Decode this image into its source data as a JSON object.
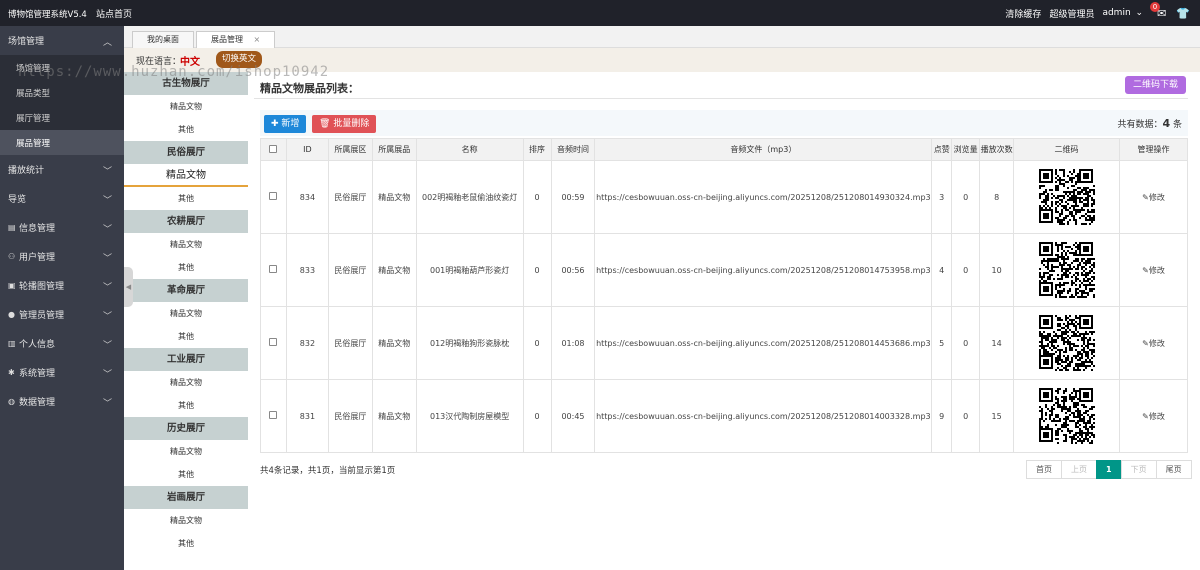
{
  "topbar": {
    "brand": "博物馆管理系统V5.4",
    "home": "站点首页",
    "clear_cache": "清除缓存",
    "role": "超级管理员",
    "user": "admin",
    "msg_count": "0"
  },
  "sidebar": {
    "groups": [
      {
        "label": "场馆管理"
      },
      {
        "label": "播放统计"
      },
      {
        "label": "导览"
      },
      {
        "label": "信息管理"
      },
      {
        "label": "用户管理"
      },
      {
        "label": "轮播图管理"
      },
      {
        "label": "管理员管理"
      },
      {
        "label": "个人信息"
      },
      {
        "label": "系统管理"
      },
      {
        "label": "数据管理"
      }
    ],
    "sub_items": [
      "场馆管理",
      "展品类型",
      "展厅管理",
      "展品管理"
    ]
  },
  "tabs": [
    {
      "label": "我的桌面"
    },
    {
      "label": "展品管理",
      "close": "×"
    }
  ],
  "lang": {
    "label": "现在语言：",
    "current": "中文",
    "switch": "切换英文"
  },
  "watermark": "https://www.huzhan.com/ishop10942",
  "hallnav": [
    {
      "hall": "古生物展厅",
      "items": [
        "精品文物",
        "其他"
      ]
    },
    {
      "hall": "民俗展厅",
      "items": [
        "精品文物",
        "其他"
      ]
    },
    {
      "hall": "农耕展厅",
      "items": [
        "精品文物",
        "其他"
      ]
    },
    {
      "hall": "革命展厅",
      "items": [
        "精品文物",
        "其他"
      ]
    },
    {
      "hall": "工业展厅",
      "items": [
        "精品文物",
        "其他"
      ]
    },
    {
      "hall": "历史展厅",
      "items": [
        "精品文物",
        "其他"
      ]
    },
    {
      "hall": "岩画展厅",
      "items": [
        "精品文物",
        "其他"
      ]
    }
  ],
  "main": {
    "title": "精品文物展品列表：",
    "qr_download": "二维码下载",
    "add": "新增",
    "batch_delete": "批量删除",
    "total_prefix": "共有数据：",
    "total": "4",
    "total_suffix": " 条",
    "columns": [
      "ID",
      "所属展区",
      "所属展品",
      "名称",
      "排序",
      "音频时间",
      "音频文件（mp3）",
      "点赞",
      "浏览量",
      "播放次数",
      "二维码",
      "管理操作"
    ],
    "rows": [
      {
        "id": "834",
        "area": "民俗展厅",
        "category": "精品文物",
        "name": "002明褐釉老鼠偷油纹瓷灯",
        "sort": "0",
        "duration": "00:59",
        "audio": "https://cesbowuuan.oss-cn-beijing.aliyuncs.com/20251208/251208014930324.mp3",
        "likes": "3",
        "views": "0",
        "plays": "8",
        "edit": "修改"
      },
      {
        "id": "833",
        "area": "民俗展厅",
        "category": "精品文物",
        "name": "001明褐釉葫芦形瓷灯",
        "sort": "0",
        "duration": "00:56",
        "audio": "https://cesbowuuan.oss-cn-beijing.aliyuncs.com/20251208/251208014753958.mp3",
        "likes": "4",
        "views": "0",
        "plays": "10",
        "edit": "修改"
      },
      {
        "id": "832",
        "area": "民俗展厅",
        "category": "精品文物",
        "name": "012明褐釉狗形瓷脉枕",
        "sort": "0",
        "duration": "01:08",
        "audio": "https://cesbowuuan.oss-cn-beijing.aliyuncs.com/20251208/251208014453686.mp3",
        "likes": "5",
        "views": "0",
        "plays": "14",
        "edit": "修改"
      },
      {
        "id": "831",
        "area": "民俗展厅",
        "category": "精品文物",
        "name": "013汉代陶制房屋模型",
        "sort": "0",
        "duration": "00:45",
        "audio": "https://cesbowuuan.oss-cn-beijing.aliyuncs.com/20251208/251208014003328.mp3",
        "likes": "9",
        "views": "0",
        "plays": "15",
        "edit": "修改"
      }
    ],
    "page_info": "共4条记录，共1页，当前显示第1页",
    "pager": {
      "first": "首页",
      "prev": "上页",
      "current": "1",
      "next": "下页",
      "last": "尾页"
    }
  },
  "colors": {
    "sidebar": "#393d49",
    "topbar": "#20222a",
    "pager_active": "#009688",
    "add": "#1e88d9",
    "delete": "#e05257",
    "qr_btn": "#b06be0"
  }
}
